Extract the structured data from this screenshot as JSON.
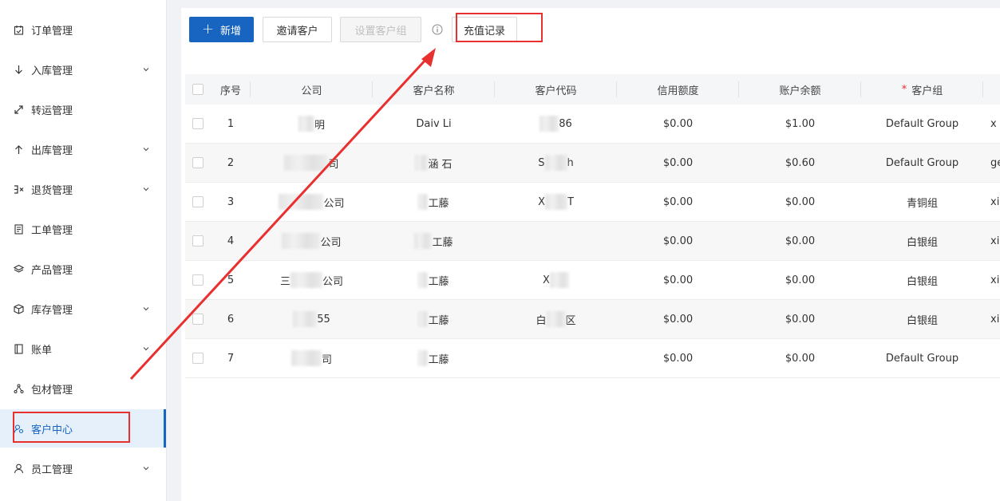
{
  "sidebar": {
    "items": [
      {
        "label": "订单管理",
        "icon": "calendar-check-icon",
        "has_chevron": false
      },
      {
        "label": "入库管理",
        "icon": "arrow-down-icon",
        "has_chevron": true
      },
      {
        "label": "转运管理",
        "icon": "diagonal-arrows-icon",
        "has_chevron": false
      },
      {
        "label": "出库管理",
        "icon": "arrow-up-icon",
        "has_chevron": true
      },
      {
        "label": "退货管理",
        "icon": "return-icon",
        "has_chevron": true
      },
      {
        "label": "工单管理",
        "icon": "document-icon",
        "has_chevron": false
      },
      {
        "label": "产品管理",
        "icon": "layers-icon",
        "has_chevron": false
      },
      {
        "label": "库存管理",
        "icon": "box-icon",
        "has_chevron": true
      },
      {
        "label": "账单",
        "icon": "book-icon",
        "has_chevron": true
      },
      {
        "label": "包材管理",
        "icon": "network-icon",
        "has_chevron": false
      },
      {
        "label": "客户中心",
        "icon": "customer-center-icon",
        "has_chevron": false,
        "active": true
      },
      {
        "label": "员工管理",
        "icon": "user-icon",
        "has_chevron": true
      }
    ]
  },
  "toolbar": {
    "add_icon": "+",
    "add_label": "新增",
    "invite_label": "邀请客户",
    "set_group_label": "设置客户组",
    "info_icon": "info-circle-icon",
    "recharge_label": "充值记录"
  },
  "table": {
    "columns": [
      "序号",
      "公司",
      "客户名称",
      "客户代码",
      "信用额度",
      "账户余额",
      "客户组"
    ],
    "required_mark": "*",
    "rows": [
      {
        "index": "1",
        "company": "明",
        "name": "Daiv Li",
        "code": "86",
        "credit": "$0.00",
        "balance": "$1.00",
        "group": "Default Group",
        "extra": "x"
      },
      {
        "index": "2",
        "company": "司",
        "name": "涵 石",
        "code_a": "S",
        "code": "h",
        "credit": "$0.00",
        "balance": "$0.60",
        "group": "Default Group",
        "extra": "ge"
      },
      {
        "index": "3",
        "company": "公司",
        "name": "工藤",
        "code_a": "X",
        "code": "T",
        "credit": "$0.00",
        "balance": "$0.00",
        "group": "青铜组",
        "extra": "xi"
      },
      {
        "index": "4",
        "company": "公司",
        "name": "工藤",
        "code": "",
        "credit": "$0.00",
        "balance": "$0.00",
        "group": "白银组",
        "extra": "xi"
      },
      {
        "index": "5",
        "company_a": "三",
        "company": "公司",
        "name": "工藤",
        "code_a": "X",
        "code": "",
        "credit": "$0.00",
        "balance": "$0.00",
        "group": "白银组",
        "extra": "xi"
      },
      {
        "index": "6",
        "company": "55",
        "name": "工藤",
        "code_a": "白",
        "code": "区",
        "credit": "$0.00",
        "balance": "$0.00",
        "group": "白银组",
        "extra": "xi"
      },
      {
        "index": "7",
        "company": "司",
        "name": "工藤",
        "code": "",
        "credit": "$0.00",
        "balance": "$0.00",
        "group": "Default Group",
        "extra": ""
      }
    ]
  },
  "colors": {
    "primary": "#1765c0",
    "annotation_red": "#e8302e"
  }
}
